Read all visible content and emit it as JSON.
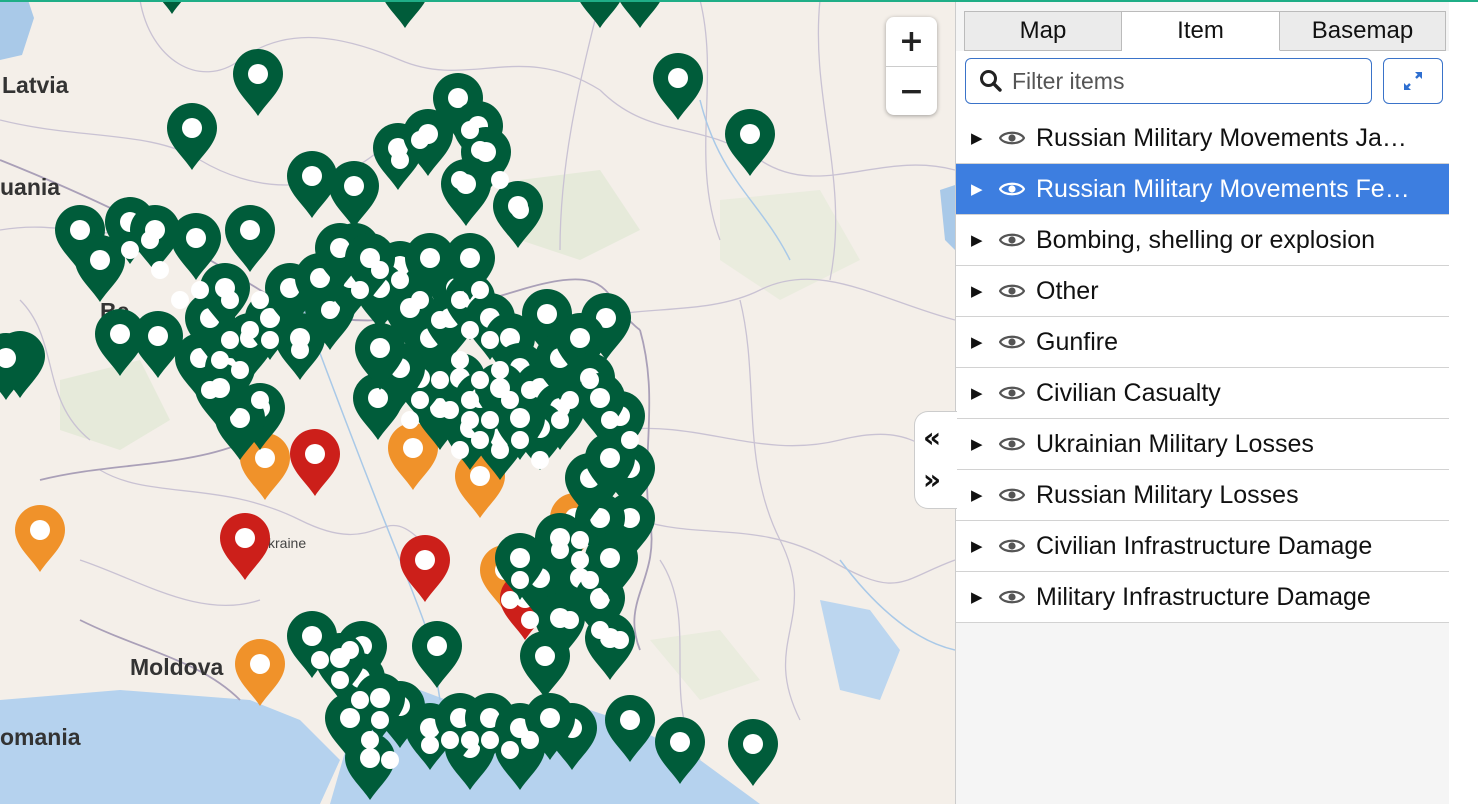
{
  "map": {
    "zoom_in": "+",
    "zoom_out": "−",
    "labels": {
      "latvia": "Latvia",
      "lithuania": "uania",
      "belarus": "Be",
      "ukraine": "kraine",
      "moldova": "Moldova",
      "romania": "omania"
    }
  },
  "colors": {
    "green": "#005c3a",
    "orange": "#f0922a",
    "red": "#cc1f1a",
    "accent": "#1fae87",
    "selected": "#3d7ee0"
  },
  "panel": {
    "tabs": [
      {
        "label": "Map"
      },
      {
        "label": "Item",
        "active": true
      },
      {
        "label": "Basemap"
      }
    ],
    "filter": {
      "placeholder": "Filter items",
      "value": ""
    },
    "items": [
      {
        "label": "Russian Military Movements Ja…",
        "selected": false
      },
      {
        "label": "Russian Military Movements Fe…",
        "selected": true
      },
      {
        "label": "Bombing, shelling or explosion",
        "selected": false
      },
      {
        "label": "Other",
        "selected": false
      },
      {
        "label": "Gunfire",
        "selected": false
      },
      {
        "label": "Civilian Casualty",
        "selected": false
      },
      {
        "label": "Ukrainian Military Losses",
        "selected": false
      },
      {
        "label": "Russian Military Losses",
        "selected": false
      },
      {
        "label": "Civilian Infrastructure Damage",
        "selected": false
      },
      {
        "label": "Military Infrastructure Damage",
        "selected": false
      }
    ]
  },
  "collapse": {
    "collapse_glyph": "«",
    "expand_glyph": "»"
  }
}
